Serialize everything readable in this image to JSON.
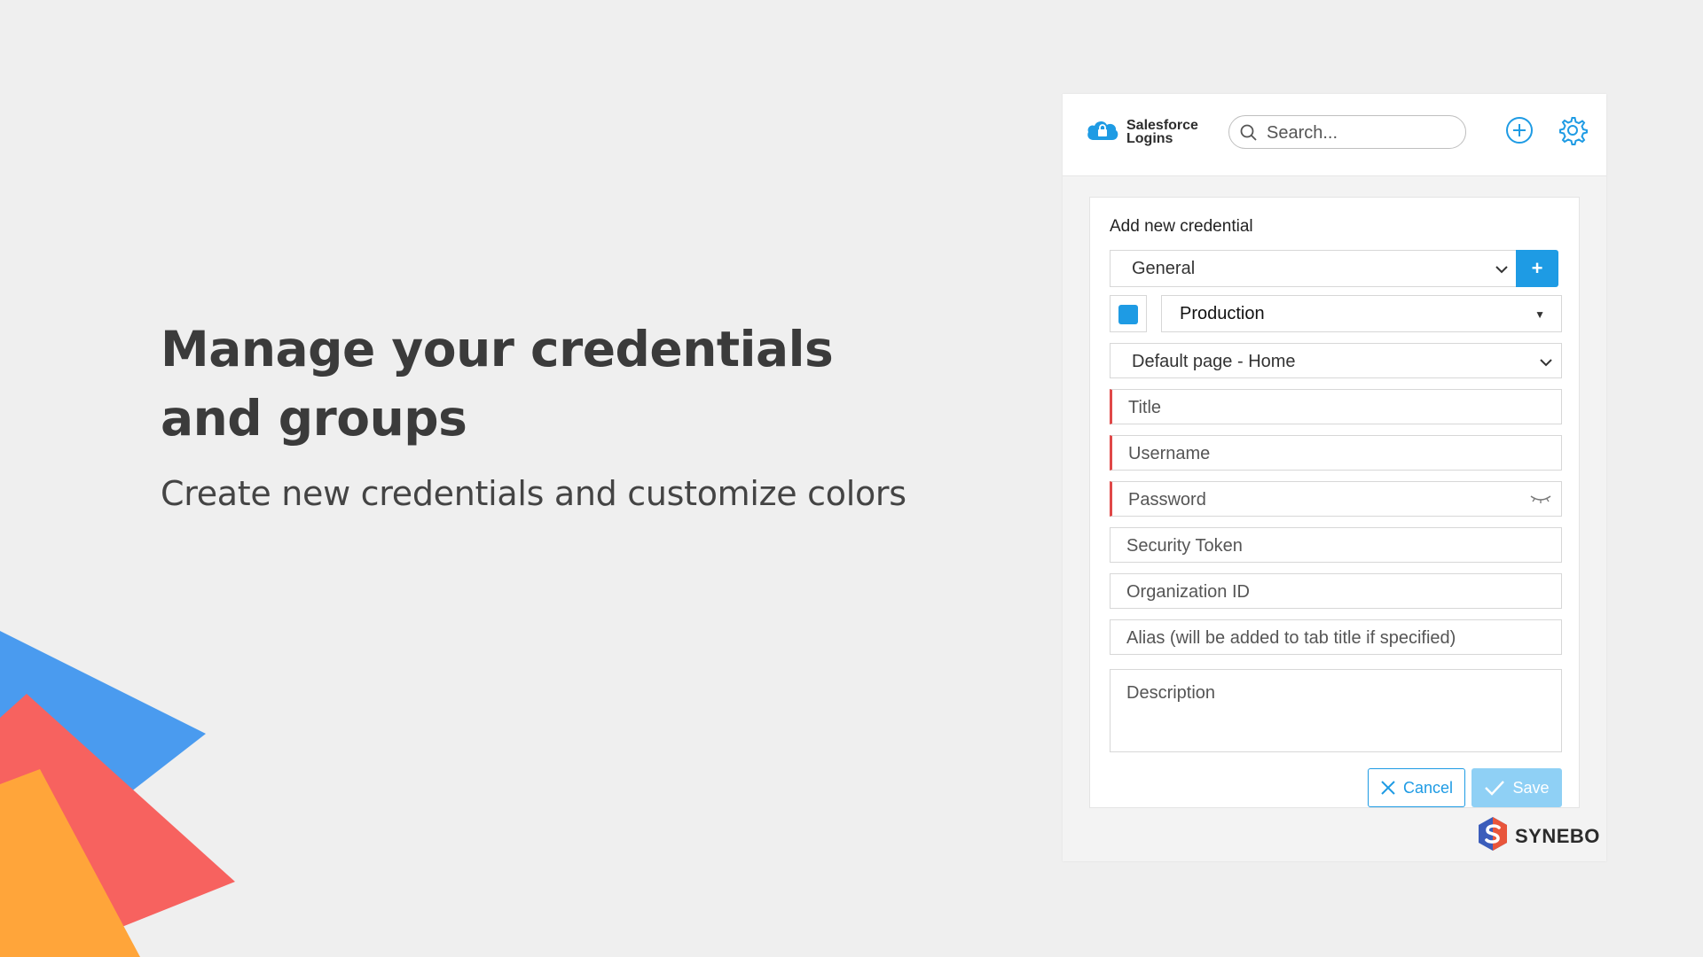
{
  "hero": {
    "title_line1": "Manage your credentials",
    "title_line2": "and groups",
    "subtitle": "Create new credentials and customize colors"
  },
  "header": {
    "brand_line1": "Salesforce",
    "brand_line2": "Logins",
    "search_placeholder": "Search...",
    "add_icon": "plus-circle-icon",
    "settings_icon": "gear-icon"
  },
  "form": {
    "title": "Add new credential",
    "group_value": "General",
    "add_group_label": "+",
    "environment_value": "Production",
    "default_page_value": "Default page - Home",
    "fields": {
      "title": "Title",
      "username": "Username",
      "password": "Password",
      "security_token": "Security Token",
      "organization_id": "Organization ID",
      "alias": "Alias (will be added to tab title if specified)",
      "description": "Description"
    },
    "cancel_label": "Cancel",
    "save_label": "Save"
  },
  "footer": {
    "logo_text": "SYNEBO"
  },
  "colors": {
    "accent": "#1e9be4",
    "accent_light": "#8fd0f5",
    "required": "#e04848",
    "color_swatch": "#1e9be4",
    "deco_blue": "#4a9bef",
    "deco_red": "#f7625f",
    "deco_orange": "#ffa53a"
  }
}
